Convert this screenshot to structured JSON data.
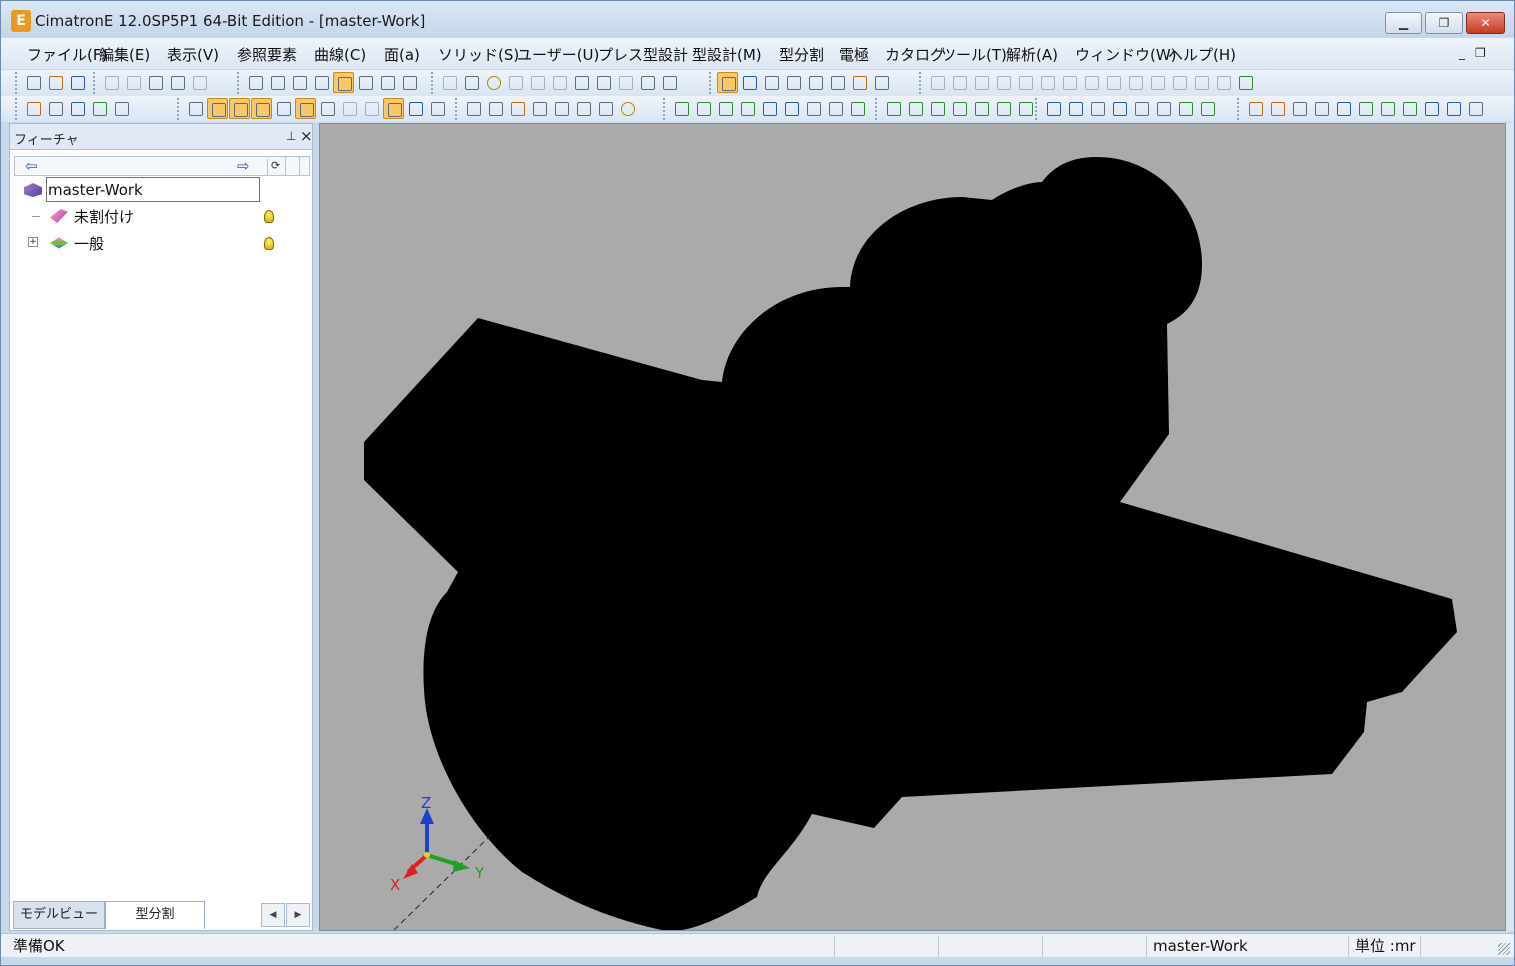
{
  "window": {
    "app_icon": "E",
    "title": "CimatronE 12.0SP5P1  64-Bit Edition - [master-Work]",
    "minimize": "▁",
    "restore": "❐",
    "close": "✕"
  },
  "menu": {
    "items": [
      "ファイル(F)",
      "編集(E)",
      "表示(V)",
      "参照要素",
      "曲線(C)",
      "面(a)",
      "ソリッド(S)",
      "ユーザー(U)",
      "プレス型設計",
      "型設計(M)",
      "型分割",
      "電極",
      "カタログ",
      "ツール(T)",
      "解析(A)",
      "ウィンドウ(W)",
      "ヘルプ(H)"
    ],
    "mdi_minimize": "_",
    "mdi_restore": "❐"
  },
  "feature_panel": {
    "title": "フィーチャ",
    "pin": "⊥",
    "close": "×",
    "nav_back": "⇦",
    "nav_forward": "⇨",
    "nav_sync": "⟳",
    "tree": [
      {
        "label": "master-Work",
        "icon": "part-icon"
      },
      {
        "label": "未割付け",
        "icon": "unassigned-icon",
        "visible": true
      },
      {
        "label": "一般",
        "icon": "general-layer-icon",
        "visible": true,
        "expander": "+"
      }
    ]
  },
  "tabs": {
    "items": [
      "モデルビュー",
      "型分割"
    ],
    "active": "型分割",
    "prev": "◀",
    "next": "▶"
  },
  "viewport": {
    "background": "#aaaaaa",
    "model_color": "#000000",
    "axes": {
      "x": "X",
      "y": "Y",
      "z": "Z"
    },
    "colors": {
      "x": "#e02020",
      "y": "#20a020",
      "z": "#2040d0"
    }
  },
  "statusbar": {
    "message": "準備OK",
    "file": "master-Work",
    "unit": "単位 :mr"
  }
}
